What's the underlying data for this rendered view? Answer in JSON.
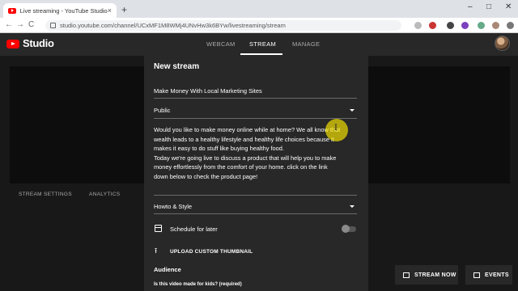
{
  "browser": {
    "tab_title": "Live streaming - YouTube Studio",
    "tab_close": "×",
    "new_tab": "+",
    "url": "studio.youtube.com/channel/UCxMF1M8WMj4UNvHw3k6BYw/livestreaming/stream",
    "window_controls": [
      "–",
      "□",
      "✕"
    ],
    "nav": [
      "←",
      "→",
      "C"
    ]
  },
  "studio": {
    "brand": "Studio",
    "tabs": [
      "WEBCAM",
      "STREAM",
      "MANAGE"
    ],
    "active_tab": "STREAM",
    "left_subtabs": [
      "STREAM SETTINGS",
      "ANALYTICS"
    ]
  },
  "modal": {
    "title": "New stream",
    "stream_title": "Make Money With Local Marketing Sites",
    "visibility": "Public",
    "description_lines": [
      "Would you like to make money online while at home? We all know that",
      "wealth leads to a healthy lifestyle and healthy life choices because it",
      "makes it easy to do stuff like buying healthy food.",
      "Today we're going live to discuss a product that will help you to make",
      "money effortlessly from the comfort of your home. click on the link",
      "down below to check the product page!"
    ],
    "category": "Howto & Style",
    "schedule_label": "Schedule for later",
    "schedule_enabled": false,
    "upload_thumbnail": "UPLOAD CUSTOM THUMBNAIL",
    "audience_heading": "Audience",
    "kids_question": "Is this video made for kids? (required)"
  },
  "actions": {
    "stream_now": "STREAM NOW",
    "events": "EVENTS"
  },
  "colors": {
    "accent_red": "#ff0000",
    "panel": "#282828",
    "background": "#1f1f1f"
  }
}
